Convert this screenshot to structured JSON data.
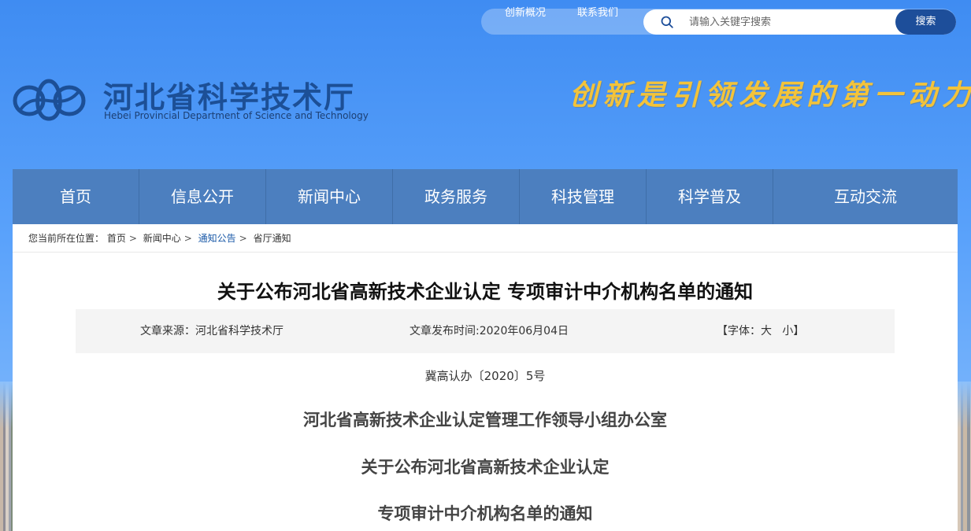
{
  "header": {
    "top_links": [
      "创新概况",
      "联系我们"
    ],
    "search_placeholder": "请输入关键字搜索",
    "search_button": "搜索",
    "org_name": "河北省科学技术厅",
    "org_name_en": "Hebei Provincial Department of Science and Technology",
    "slogan": "创新是引领发展的第一动力"
  },
  "nav": {
    "items": [
      "首页",
      "信息公开",
      "新闻中心",
      "政务服务",
      "科技管理",
      "科学普及",
      "互动交流"
    ]
  },
  "breadcrumb": {
    "prefix": "您当前所在位置：",
    "items": [
      "首页",
      "新闻中心",
      "通知公告",
      "省厅通知"
    ]
  },
  "article": {
    "title": "关于公布河北省高新技术企业认定  专项审计中介机构名单的通知",
    "source": "文章来源：河北省科学技术厅",
    "date": "文章发布时间:2020年06月04日",
    "font_label_open": "【字体：",
    "font_large": "大",
    "font_small": "小",
    "font_label_close": "】",
    "doc_number": "冀高认办〔2020〕5号",
    "body": [
      "河北省高新技术企业认定管理工作领导小组办公室",
      "关于公布河北省高新技术企业认定",
      "专项审计中介机构名单的通知"
    ]
  },
  "colors": {
    "nav_bg": "#4c7fbf",
    "brand_blue": "#1c4f96",
    "slogan_gold": "#f3c33a",
    "search_button_bg": "#1d4e9a"
  }
}
